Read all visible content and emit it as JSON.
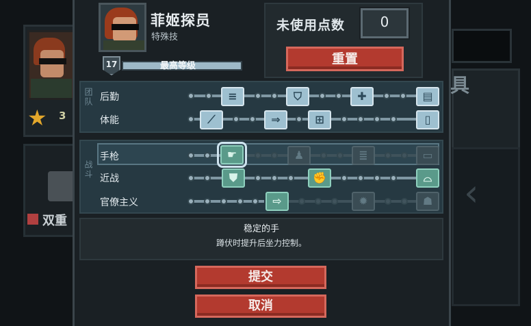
{
  "character": {
    "name": "菲姬探员",
    "role": "特殊技"
  },
  "level": {
    "badge": "17",
    "label": "最高等级"
  },
  "points": {
    "label": "未使用点数",
    "value": "0"
  },
  "buttons": {
    "reset": "重置",
    "submit": "提交",
    "cancel": "取消"
  },
  "sections": {
    "team": {
      "label": "团队",
      "rows": [
        {
          "label": "后勤"
        },
        {
          "label": "体能"
        }
      ]
    },
    "combat": {
      "label": "战斗",
      "rows": [
        {
          "label": "手枪"
        },
        {
          "label": "近战"
        },
        {
          "label": "官僚主义"
        }
      ]
    }
  },
  "description": {
    "title": "稳定的手",
    "text": "蹲伏时提升后坐力控制。"
  },
  "background": {
    "star_count": "3",
    "text_fragment": "双重",
    "right_fragment": "具"
  },
  "icons": {
    "logistics": [
      "ammo-icon",
      "shield-plus-icon",
      "medkit-icon",
      "inventory-icon"
    ],
    "fitness": [
      "sprint-icon",
      "dash-icon",
      "grid-icon",
      "door-icon"
    ],
    "pistol": [
      "steady-hand-icon",
      "agent-icon",
      "ammo-plus-icon",
      "battery-icon"
    ],
    "melee": [
      "shield-icon",
      "fist-icon",
      "helmet-icon"
    ],
    "bureaucracy": [
      "exit-icon",
      "mine-icon",
      "officer-icon"
    ]
  },
  "colors": {
    "accent_red": "#b33a2f",
    "skill_active": "#9ec0d0",
    "skill_green": "#5a9a8a",
    "panel": "#263942"
  }
}
